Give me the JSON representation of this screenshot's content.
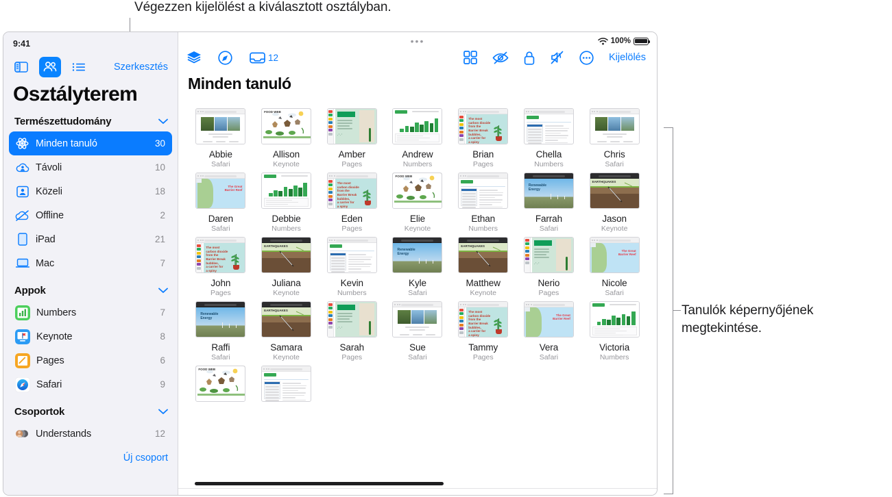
{
  "annotations": {
    "top_callout": "Végezzen kijelölést a kiválasztott osztályban.",
    "right_callout": "Tanulók képernyőjének megtekintése."
  },
  "status_bar": {
    "time": "9:41",
    "wifi_icon": "wifi-icon",
    "battery_percent": "100%",
    "battery_icon": "battery-icon"
  },
  "sidebar": {
    "segmented": [
      {
        "name": "sidebar-toggle-icon",
        "icon": "sidebar-icon",
        "active": false
      },
      {
        "name": "students-view-icon",
        "icon": "people-icon",
        "active": true
      },
      {
        "name": "list-view-icon",
        "icon": "list-icon",
        "active": false
      }
    ],
    "edit_label": "Szerkesztés",
    "title": "Osztályterem",
    "class_section": {
      "label": "Természettudomány",
      "chevron": "chevron-down-icon"
    },
    "class_items": [
      {
        "icon": "atom-icon",
        "label": "Minden tanuló",
        "count": "30",
        "selected": true
      },
      {
        "icon": "cloud-person-icon",
        "label": "Távoli",
        "count": "10",
        "selected": false
      },
      {
        "icon": "person-frame-icon",
        "label": "Közeli",
        "count": "18",
        "selected": false
      },
      {
        "icon": "cloud-slash-icon",
        "label": "Offline",
        "count": "2",
        "selected": false
      },
      {
        "icon": "ipad-icon",
        "label": "iPad",
        "count": "21",
        "selected": false
      },
      {
        "icon": "mac-icon",
        "label": "Mac",
        "count": "7",
        "selected": false
      }
    ],
    "apps_section": {
      "label": "Appok",
      "chevron": "chevron-down-icon"
    },
    "apps": [
      {
        "icon": "numbers-app-icon",
        "label": "Numbers",
        "count": "7",
        "color": "#4ccf5c"
      },
      {
        "icon": "keynote-app-icon",
        "label": "Keynote",
        "count": "8",
        "color": "#2b9bf4"
      },
      {
        "icon": "pages-app-icon",
        "label": "Pages",
        "count": "6",
        "color": "#f6a623"
      },
      {
        "icon": "safari-app-icon",
        "label": "Safari",
        "count": "9",
        "color": "#ffffff"
      }
    ],
    "groups_section": {
      "label": "Csoportok",
      "chevron": "chevron-down-icon"
    },
    "groups": [
      {
        "icon": "group-avatars-icon",
        "label": "Understands",
        "count": "12"
      }
    ],
    "new_group_label": "Új csoport"
  },
  "main": {
    "toolbar_left": [
      {
        "name": "layers-icon",
        "label": ""
      },
      {
        "name": "navigate-icon",
        "label": ""
      },
      {
        "name": "tray-icon",
        "label": "12"
      }
    ],
    "toolbar_right": [
      {
        "name": "grid-view-icon"
      },
      {
        "name": "hide-screen-icon"
      },
      {
        "name": "lock-icon"
      },
      {
        "name": "mute-icon"
      },
      {
        "name": "more-options-icon"
      }
    ],
    "select_label": "Kijelölés",
    "page_title": "Minden tanuló",
    "students": [
      {
        "name": "Abbie",
        "app": "Safari",
        "art": "safari-woods"
      },
      {
        "name": "Allison",
        "app": "Keynote",
        "art": "foodweb"
      },
      {
        "name": "Amber",
        "app": "Pages",
        "art": "pages-green"
      },
      {
        "name": "Andrew",
        "app": "Numbers",
        "art": "numbers"
      },
      {
        "name": "Brian",
        "app": "Pages",
        "art": "pages-teal"
      },
      {
        "name": "Chella",
        "app": "Numbers",
        "art": "doc-table"
      },
      {
        "name": "Chris",
        "app": "Safari",
        "art": "safari-woods"
      },
      {
        "name": "Daren",
        "app": "Safari",
        "art": "reef"
      },
      {
        "name": "Debbie",
        "app": "Numbers",
        "art": "numbers"
      },
      {
        "name": "Eden",
        "app": "Pages",
        "art": "pages-teal"
      },
      {
        "name": "Elie",
        "app": "Keynote",
        "art": "foodweb"
      },
      {
        "name": "Ethan",
        "app": "Numbers",
        "art": "doc-table"
      },
      {
        "name": "Farrah",
        "app": "Safari",
        "art": "renew"
      },
      {
        "name": "Jason",
        "app": "Keynote",
        "art": "quake"
      },
      {
        "name": "John",
        "app": "Pages",
        "art": "pages-teal"
      },
      {
        "name": "Juliana",
        "app": "Keynote",
        "art": "quake"
      },
      {
        "name": "Kevin",
        "app": "Numbers",
        "art": "doc-table"
      },
      {
        "name": "Kyle",
        "app": "Safari",
        "art": "renew"
      },
      {
        "name": "Matthew",
        "app": "Keynote",
        "art": "quake"
      },
      {
        "name": "Nerio",
        "app": "Pages",
        "art": "pages-green"
      },
      {
        "name": "Nicole",
        "app": "Safari",
        "art": "reef"
      },
      {
        "name": "Raffi",
        "app": "Safari",
        "art": "renew"
      },
      {
        "name": "Samara",
        "app": "Keynote",
        "art": "quake"
      },
      {
        "name": "Sarah",
        "app": "Pages",
        "art": "pages-green"
      },
      {
        "name": "Sue",
        "app": "Safari",
        "art": "safari-woods"
      },
      {
        "name": "Tammy",
        "app": "Pages",
        "art": "pages-teal"
      },
      {
        "name": "Vera",
        "app": "Safari",
        "art": "reef"
      },
      {
        "name": "Victoria",
        "app": "Numbers",
        "art": "numbers"
      },
      {
        "name": "",
        "app": "",
        "art": "foodweb"
      },
      {
        "name": "",
        "app": "",
        "art": "doc-table"
      }
    ]
  }
}
